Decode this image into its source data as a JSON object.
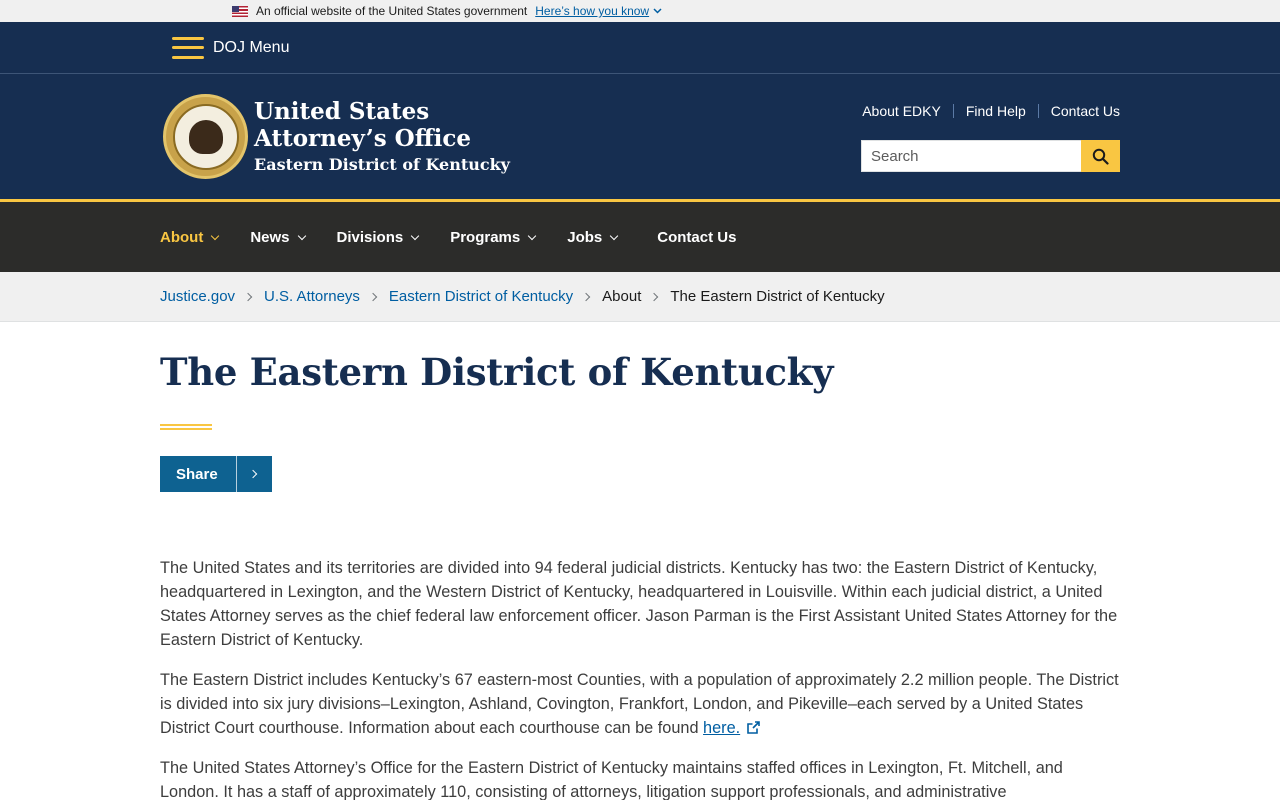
{
  "gov_banner": {
    "text": "An official website of the United States government",
    "link": "Here’s how you know"
  },
  "doj_menu": {
    "label": "DOJ Menu"
  },
  "header": {
    "title_line1": "United States",
    "title_line2": "Attorney’s Office",
    "subtitle": "Eastern District of Kentucky",
    "utility_links": [
      "About EDKY",
      "Find Help",
      "Contact Us"
    ],
    "search_placeholder": "Search"
  },
  "nav": {
    "items": [
      {
        "label": "About",
        "active": true
      },
      {
        "label": "News"
      },
      {
        "label": "Divisions"
      },
      {
        "label": "Programs"
      },
      {
        "label": "Jobs"
      }
    ],
    "contact": "Contact Us"
  },
  "breadcrumb": {
    "links": [
      "Justice.gov",
      "U.S. Attorneys",
      "Eastern District of Kentucky"
    ],
    "plain": [
      "About",
      "The Eastern District of Kentucky"
    ]
  },
  "page": {
    "title": "The Eastern District of Kentucky",
    "share_label": "Share",
    "paragraphs": [
      "The United States and its territories are divided into 94 federal judicial districts.  Kentucky has two:  the Eastern District of Kentucky, headquartered in Lexington, and the Western District of Kentucky, headquartered in Louisville.  Within each judicial district, a United States Attorney serves as the chief federal law enforcement officer.  Jason Parman is the First Assistant United States Attorney for the Eastern District of Kentucky.",
      "The Eastern District includes Kentucky’s 67 eastern-most Counties, with a population of approximately 2.2 million people.  The District is divided into six jury divisions–Lexington, Ashland, Covington, Frankfort, London, and Pikeville–each served by a United States District Court courthouse.  Information about each courthouse can be found ",
      "The United States Attorney’s Office for the Eastern District of Kentucky maintains staffed offices in Lexington, Ft. Mitchell, and London.  It has a staff of approximately 110, consisting of attorneys, litigation support professionals, and administrative"
    ],
    "link_text": "here."
  },
  "colors": {
    "navy": "#162e51",
    "gold": "#f9c642",
    "nav_bg": "#2c2c2a",
    "link": "#005ea2",
    "share_bg": "#0e6291"
  }
}
